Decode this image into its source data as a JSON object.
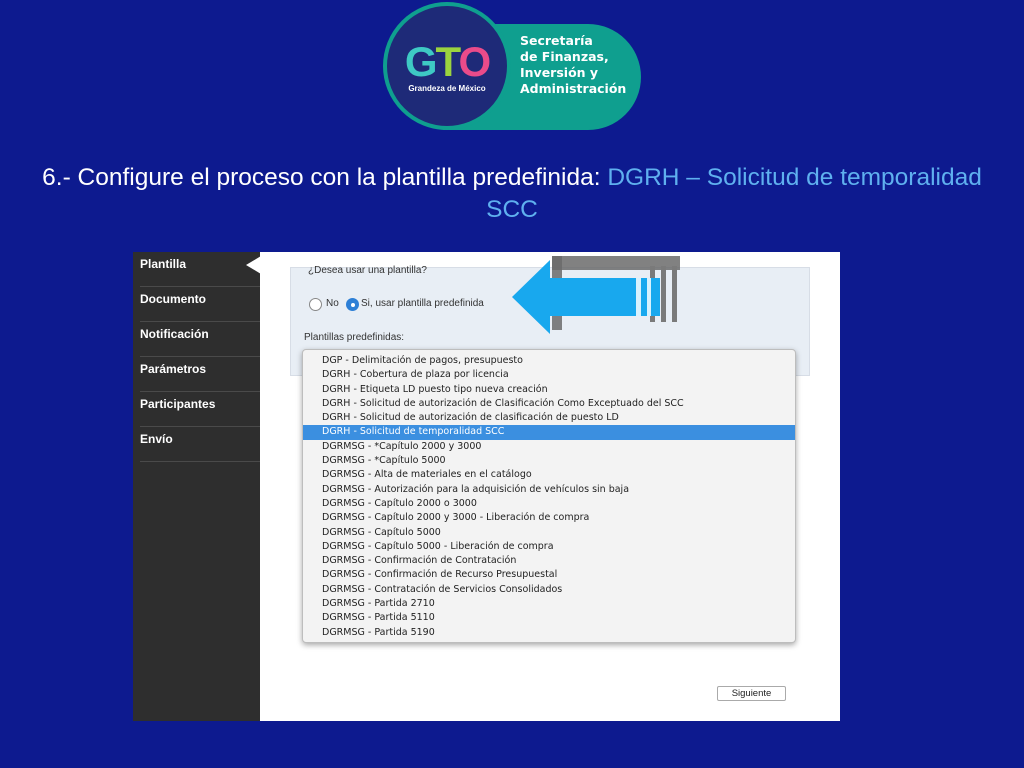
{
  "logo": {
    "brand": "GTO",
    "tagline": "Grandeza de México",
    "department": [
      "Secretaría",
      "de Finanzas,",
      "Inversión y",
      "Administración"
    ]
  },
  "title": {
    "prefix": "6.- Configure el proceso con la plantilla predefinida:",
    "highlight": "DGRH – Solicitud de temporalidad SCC"
  },
  "sidebar": {
    "items": [
      "Plantilla",
      "Documento",
      "Notificación",
      "Parámetros",
      "Participantes",
      "Envío"
    ],
    "active": 0
  },
  "form": {
    "question": "¿Desea usar una plantilla?",
    "option_no": "No",
    "option_yes": "Si, usar plantilla predefinida",
    "selected_option": "yes",
    "templates_label": "Plantillas predefinidas:"
  },
  "dropdown": {
    "options": [
      "DGP - Delimitación de pagos, presupuesto",
      "DGRH - Cobertura de plaza por licencia",
      "DGRH - Etiqueta LD puesto tipo nueva creación",
      "DGRH - Solicitud de autorización de Clasificación Como Exceptuado del SCC",
      "DGRH - Solicitud de autorización de clasificación de puesto LD",
      "DGRH - Solicitud de temporalidad SCC",
      "DGRMSG - *Capítulo 2000 y 3000",
      "DGRMSG - *Capítulo 5000",
      "DGRMSG - Alta de materiales en el catálogo",
      "DGRMSG - Autorización para la adquisición de vehículos sin baja",
      "DGRMSG - Capítulo 2000 o 3000",
      "DGRMSG - Capítulo 2000 y 3000 - Liberación de compra",
      "DGRMSG - Capítulo 5000",
      "DGRMSG - Capítulo 5000 - Liberación de compra",
      "DGRMSG - Confirmación de Contratación",
      "DGRMSG - Confirmación de Recurso Presupuestal",
      "DGRMSG - Contratación de Servicios Consolidados",
      "DGRMSG - Partida 2710",
      "DGRMSG - Partida 5110",
      "DGRMSG - Partida 5190"
    ],
    "selected_index": 5
  },
  "buttons": {
    "next": "Siguiente"
  },
  "colors": {
    "background": "#0d1a8f",
    "highlight_text": "#5fb0ef",
    "selection": "#3b8fe0",
    "arrow": "#18a8ee",
    "sidebar": "#2e2e2e"
  }
}
